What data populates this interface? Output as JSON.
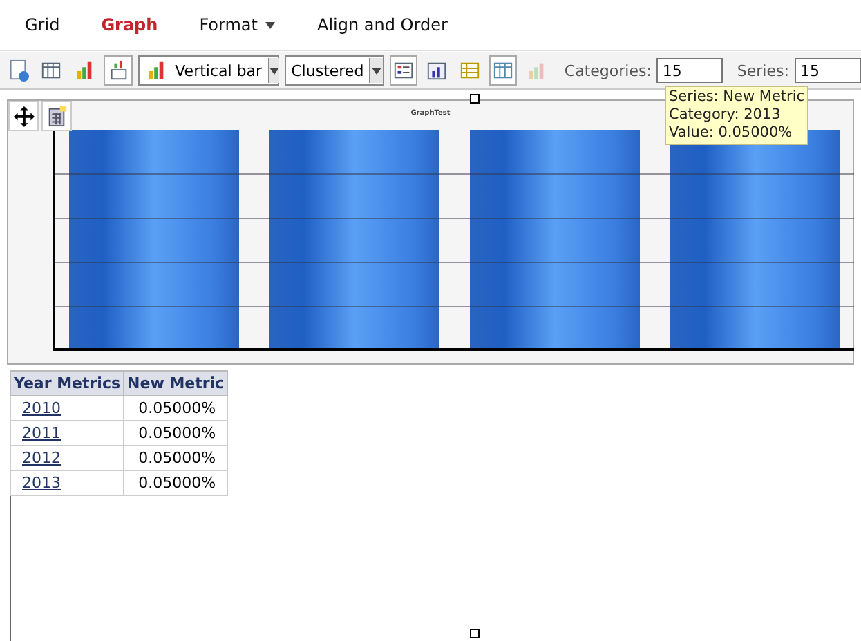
{
  "menu": [
    {
      "label": "Grid",
      "selected": false,
      "dropdown": false
    },
    {
      "label": "Graph",
      "selected": true,
      "dropdown": false
    },
    {
      "label": "Format",
      "selected": false,
      "dropdown": true
    },
    {
      "label": "Align and Order",
      "selected": false,
      "dropdown": false
    }
  ],
  "toolbar": {
    "chart_type": "Vertical bar",
    "layout": "Clustered",
    "categories_label": "Categories:",
    "categories_value": "15",
    "series_label": "Series:",
    "series_value": "15"
  },
  "chart": {
    "title": "GraphTest"
  },
  "tooltip": {
    "lines": [
      "Series: New Metric",
      "Category: 2013",
      "Value: 0.05000%"
    ]
  },
  "table": {
    "columns": [
      "Year Metrics",
      "New Metric"
    ],
    "rows": [
      {
        "year": "2010",
        "value": "0.05000%"
      },
      {
        "year": "2011",
        "value": "0.05000%"
      },
      {
        "year": "2012",
        "value": "0.05000%"
      },
      {
        "year": "2013",
        "value": "0.05000%"
      }
    ]
  }
}
